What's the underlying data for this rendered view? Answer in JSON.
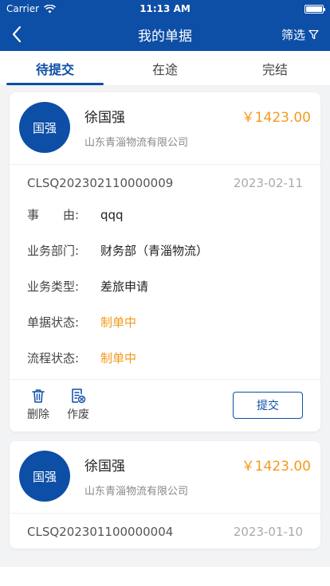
{
  "status_bar": {
    "carrier": "Carrier",
    "time": "11:13 AM",
    "battery_level": 1.0
  },
  "nav": {
    "title": "我的单据",
    "filter_label": "筛选"
  },
  "tabs": [
    {
      "label": "待提交",
      "active": true
    },
    {
      "label": "在途",
      "active": false
    },
    {
      "label": "完结",
      "active": false
    }
  ],
  "labels": {
    "reason": "事　　由:",
    "department": "业务部门:",
    "business_type": "业务类型:",
    "doc_status": "单据状态:",
    "flow_status": "流程状态:",
    "delete": "删除",
    "void": "作废",
    "submit": "提交"
  },
  "cards": [
    {
      "avatar": "国强",
      "name": "徐国强",
      "amount": "￥1423.00",
      "company": "山东青淄物流有限公司",
      "doc_no": "CLSQ202302110000009",
      "date": "2023-02-11",
      "reason": "qqq",
      "department": "财务部（青淄物流）",
      "business_type": "差旅申请",
      "doc_status": "制单中",
      "flow_status": "制单中"
    },
    {
      "avatar": "国强",
      "name": "徐国强",
      "amount": "￥1423.00",
      "company": "山东青淄物流有限公司",
      "doc_no": "CLSQ202301100000004",
      "date": "2023-01-10"
    }
  ],
  "colors": {
    "primary": "#0d4ea6",
    "accent": "#f39a1a"
  }
}
